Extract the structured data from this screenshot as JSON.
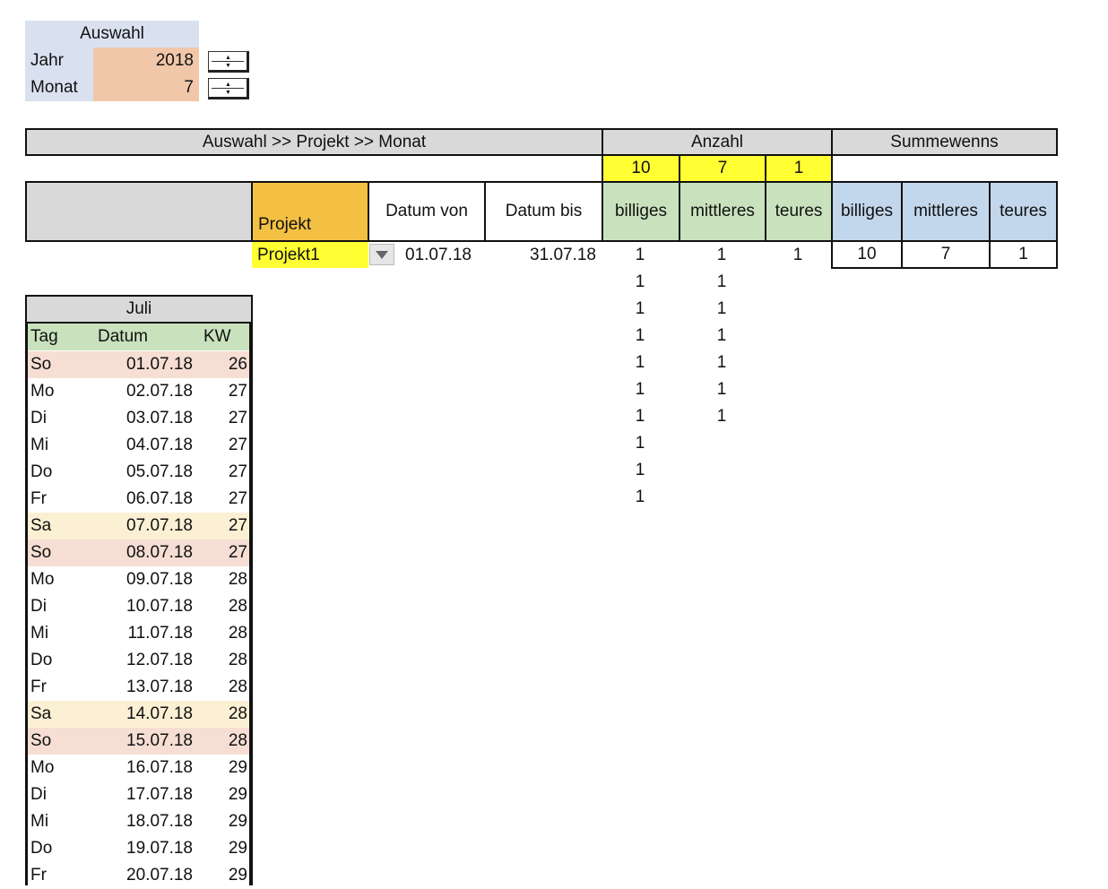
{
  "selection": {
    "header": "Auswahl",
    "year_label": "Jahr",
    "year_value": "2018",
    "month_label": "Monat",
    "month_value": "7",
    "spinner_icon": "spinner-arrows"
  },
  "top_header": {
    "path": "Auswahl >> Projekt >> Monat",
    "anzahl": "Anzahl",
    "summewenns": "Summewenns"
  },
  "totals": [
    "10",
    "7",
    "1"
  ],
  "columns": {
    "projekt": "Projekt",
    "datum_von": "Datum von",
    "datum_bis": "Datum bis",
    "count_headers": [
      "billiges",
      "mittleres",
      "teures"
    ],
    "sum_headers": [
      "billiges",
      "mittleres",
      "teures"
    ]
  },
  "project_row": {
    "projekt": "Projekt1",
    "dropdown_icon": "triangle-down",
    "datum_von": "01.07.18",
    "datum_bis": "31.07.18",
    "counts": [
      "1",
      "1",
      "1"
    ],
    "sums": [
      "10",
      "7",
      "1"
    ]
  },
  "extra_counts": {
    "billiges": [
      "1",
      "1",
      "1",
      "1",
      "1",
      "1",
      "1",
      "1",
      "1"
    ],
    "mittleres": [
      "1",
      "1",
      "1",
      "1",
      "1",
      "1"
    ]
  },
  "calendar": {
    "month_title": "Juli",
    "headers": [
      "Tag",
      "Datum",
      "KW"
    ],
    "rows": [
      {
        "tag": "So",
        "datum": "01.07.18",
        "kw": "26",
        "type": "so"
      },
      {
        "tag": "Mo",
        "datum": "02.07.18",
        "kw": "27",
        "type": ""
      },
      {
        "tag": "Di",
        "datum": "03.07.18",
        "kw": "27",
        "type": ""
      },
      {
        "tag": "Mi",
        "datum": "04.07.18",
        "kw": "27",
        "type": ""
      },
      {
        "tag": "Do",
        "datum": "05.07.18",
        "kw": "27",
        "type": ""
      },
      {
        "tag": "Fr",
        "datum": "06.07.18",
        "kw": "27",
        "type": ""
      },
      {
        "tag": "Sa",
        "datum": "07.07.18",
        "kw": "27",
        "type": "sa"
      },
      {
        "tag": "So",
        "datum": "08.07.18",
        "kw": "27",
        "type": "so"
      },
      {
        "tag": "Mo",
        "datum": "09.07.18",
        "kw": "28",
        "type": ""
      },
      {
        "tag": "Di",
        "datum": "10.07.18",
        "kw": "28",
        "type": ""
      },
      {
        "tag": "Mi",
        "datum": "11.07.18",
        "kw": "28",
        "type": ""
      },
      {
        "tag": "Do",
        "datum": "12.07.18",
        "kw": "28",
        "type": ""
      },
      {
        "tag": "Fr",
        "datum": "13.07.18",
        "kw": "28",
        "type": ""
      },
      {
        "tag": "Sa",
        "datum": "14.07.18",
        "kw": "28",
        "type": "sa"
      },
      {
        "tag": "So",
        "datum": "15.07.18",
        "kw": "28",
        "type": "so"
      },
      {
        "tag": "Mo",
        "datum": "16.07.18",
        "kw": "29",
        "type": ""
      },
      {
        "tag": "Di",
        "datum": "17.07.18",
        "kw": "29",
        "type": ""
      },
      {
        "tag": "Mi",
        "datum": "18.07.18",
        "kw": "29",
        "type": ""
      },
      {
        "tag": "Do",
        "datum": "19.07.18",
        "kw": "29",
        "type": ""
      },
      {
        "tag": "Fr",
        "datum": "20.07.18",
        "kw": "29",
        "type": ""
      }
    ]
  },
  "colors": {
    "gray_header": "#d9d9d9",
    "green_header": "#c9e2bd",
    "blue_header": "#c2d6ec",
    "yellow": "#ffff33",
    "orange": "#f4c043",
    "peach": "#f1c7a9",
    "light_blue": "#d9e1f1",
    "sunday_row": "#f6ded4",
    "saturday_row": "#fbf0d3"
  }
}
